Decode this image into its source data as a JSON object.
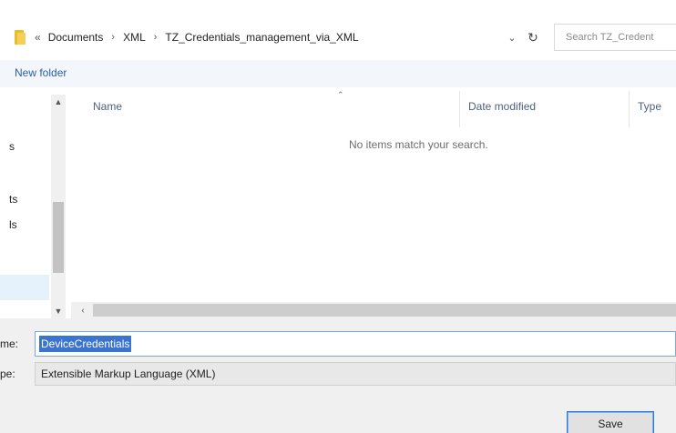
{
  "address_bar": {
    "crumbs": [
      "Documents",
      "XML",
      "TZ_Credentials_management_via_XML"
    ],
    "separator_first": "«",
    "separator": "›"
  },
  "search": {
    "placeholder": "Search TZ_Credent"
  },
  "toolbar": {
    "new_folder_label": "New folder"
  },
  "nav_pane": {
    "items": [
      "s",
      "ts",
      "ls"
    ]
  },
  "file_list": {
    "columns": [
      "Name",
      "Date modified",
      "Type"
    ],
    "empty_message": "No items match your search."
  },
  "form": {
    "filename_label": "me:",
    "filename_value": "DeviceCredentials",
    "savetype_label": "pe:",
    "savetype_value": "Extensible Markup Language (XML)"
  },
  "buttons": {
    "save_label": "Save"
  },
  "colors": {
    "selection": "#3b73d1",
    "link": "#2b5ea8",
    "folder": "#e8bd2c"
  }
}
